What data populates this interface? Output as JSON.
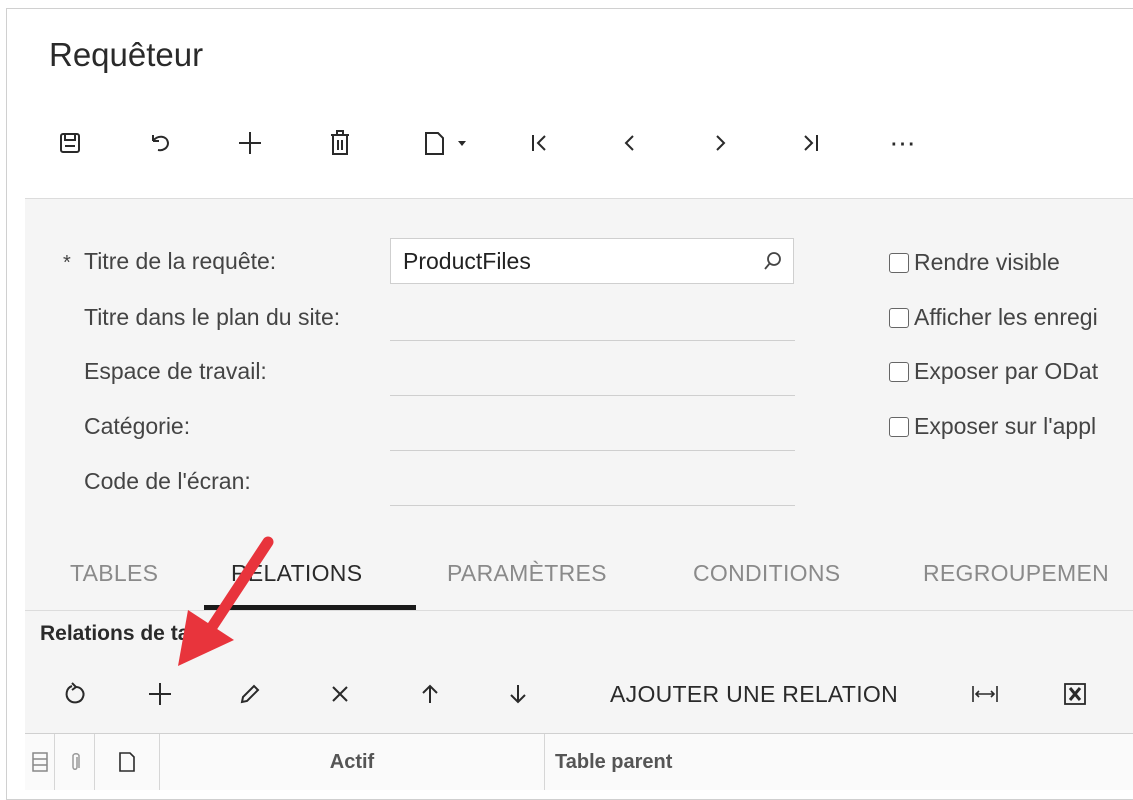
{
  "page": {
    "title": "Requêteur"
  },
  "toolbar": {
    "save": "save-icon",
    "undo": "undo-icon",
    "add": "plus-icon",
    "delete": "trash-icon",
    "copy": "copy-paste-icon",
    "first": "first-record-icon",
    "prev": "previous-icon",
    "next": "next-icon",
    "last": "last-record-icon",
    "more": "⋯"
  },
  "form": {
    "required_mark": "*",
    "fields": [
      {
        "label": "Titre de la requête:",
        "value": "ProductFiles"
      },
      {
        "label": "Titre dans le plan du site:",
        "value": ""
      },
      {
        "label": "Espace de travail:",
        "value": ""
      },
      {
        "label": "Catégorie:",
        "value": ""
      },
      {
        "label": "Code de l'écran:",
        "value": ""
      }
    ],
    "checkboxes": [
      {
        "label": "Rendre visible",
        "checked": false
      },
      {
        "label": "Afficher les enregi",
        "checked": false
      },
      {
        "label": "Exposer par ODat",
        "checked": false
      },
      {
        "label": "Exposer sur l'appl",
        "checked": false
      }
    ]
  },
  "tabs": [
    {
      "label": "TABLES",
      "active": false
    },
    {
      "label": "RELATIONS",
      "active": true
    },
    {
      "label": "PARAMÈTRES",
      "active": false
    },
    {
      "label": "CONDITIONS",
      "active": false
    },
    {
      "label": "REGROUPEMEN",
      "active": false
    }
  ],
  "relations": {
    "title": "Relations de table",
    "toolbar": {
      "add_relation": "AJOUTER UNE RELATION"
    },
    "columns": [
      "Actif",
      "Table parent"
    ]
  },
  "colors": {
    "annotation_arrow": "#e8343c",
    "tab_underline": "#1a1a1a",
    "panel_bg": "#f5f5f5"
  }
}
